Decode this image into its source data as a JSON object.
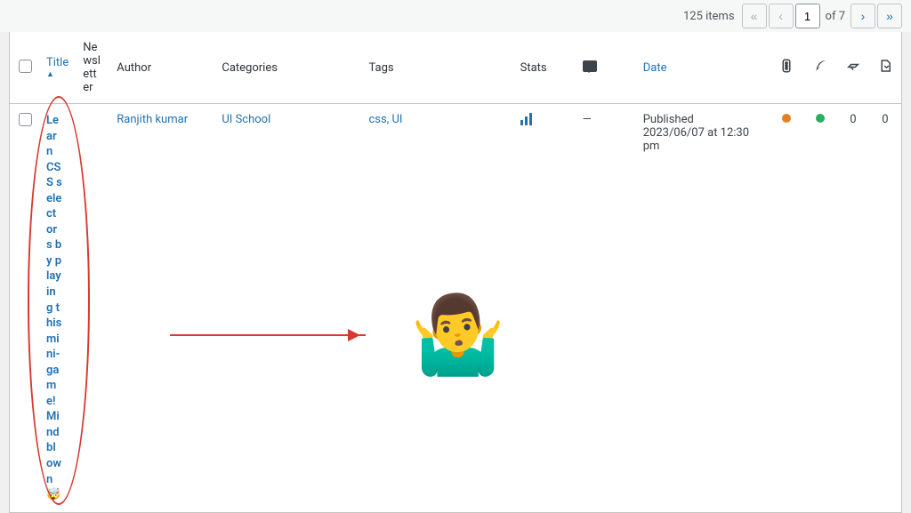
{
  "pagination": {
    "items_count": "125 items",
    "first": "«",
    "prev": "‹",
    "current_page": "1",
    "of_text": "of 7",
    "next": "›",
    "last": "»"
  },
  "columns": {
    "title": "Title",
    "newsletter": "Newsletter",
    "author": "Author",
    "categories": "Categories",
    "tags": "Tags",
    "stats": "Stats",
    "date": "Date"
  },
  "row": {
    "title": "Learn CSS selectors by playing this mini-game! Mindblown 🤯",
    "author": "Ranjith kumar",
    "categories": "UI School",
    "tags": "css, UI",
    "comments": "—",
    "date_status": "Published",
    "date_value": "2023/06/07 at 12:30 pm",
    "count1": "0",
    "count2": "0"
  },
  "annotation_emoji": "🤷‍♂️"
}
